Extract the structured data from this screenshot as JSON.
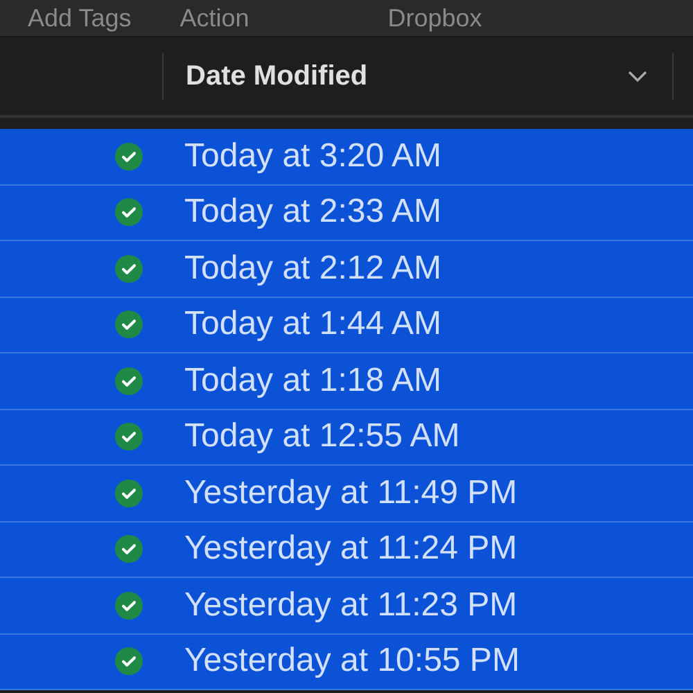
{
  "toolbar": {
    "items": [
      "Add Tags",
      "Action",
      "Dropbox"
    ]
  },
  "columns": [
    {
      "label": "Date Modified",
      "sorted": true
    }
  ],
  "rows": [
    {
      "date": "Today at 3:20 AM",
      "synced": true,
      "selected": true
    },
    {
      "date": "Today at 2:33 AM",
      "synced": true,
      "selected": true
    },
    {
      "date": "Today at 2:12 AM",
      "synced": true,
      "selected": true
    },
    {
      "date": "Today at 1:44 AM",
      "synced": true,
      "selected": true
    },
    {
      "date": "Today at 1:18 AM",
      "synced": true,
      "selected": true
    },
    {
      "date": "Today at 12:55 AM",
      "synced": true,
      "selected": true
    },
    {
      "date": "Yesterday at 11:49 PM",
      "synced": true,
      "selected": true
    },
    {
      "date": "Yesterday at 11:24 PM",
      "synced": true,
      "selected": true
    },
    {
      "date": "Yesterday at 11:23 PM",
      "synced": true,
      "selected": true
    },
    {
      "date": "Yesterday at 10:55 PM",
      "synced": true,
      "selected": true
    }
  ]
}
